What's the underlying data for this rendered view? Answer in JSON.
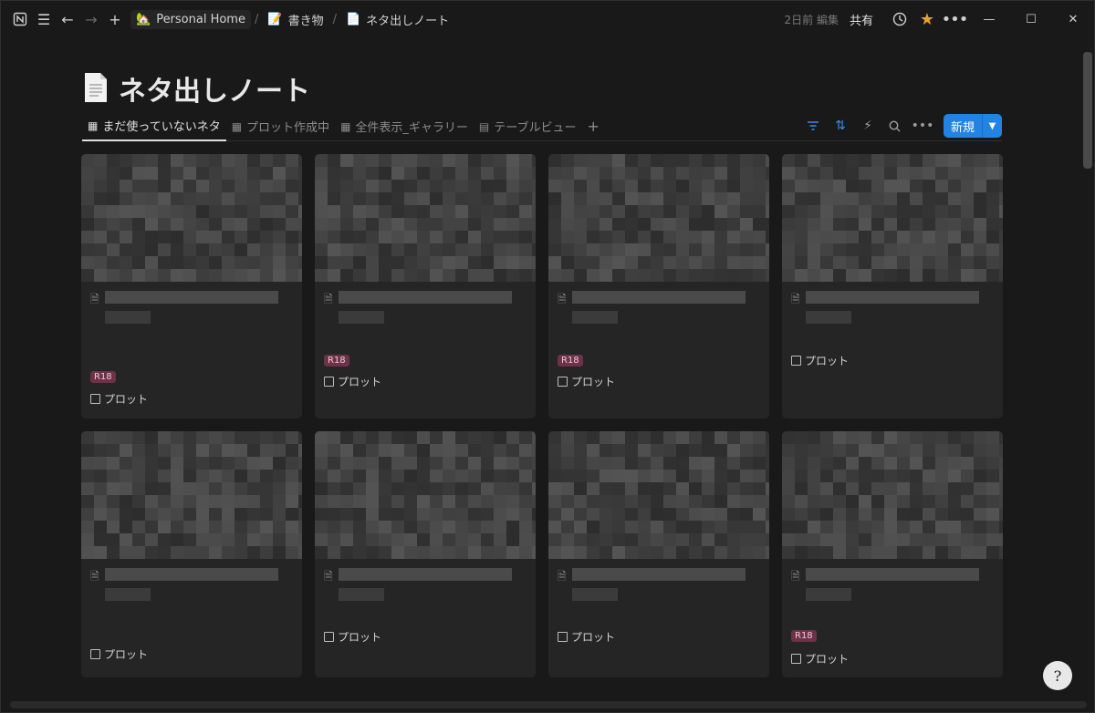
{
  "titlebar": {
    "breadcrumbs": [
      {
        "icon": "house-emoji",
        "label": "Personal Home"
      },
      {
        "icon": "memo-emoji",
        "label": "書き物"
      },
      {
        "icon": "page-icon",
        "label": "ネタ出しノート"
      }
    ],
    "edited": "2日前 編集",
    "share": "共有"
  },
  "page": {
    "title": "ネタ出しノート",
    "tabs": [
      {
        "label": "まだ使っていないネタ",
        "icon": "gallery-icon",
        "active": true
      },
      {
        "label": "プロット作成中",
        "icon": "gallery-icon"
      },
      {
        "label": "全件表示_ギャラリー",
        "icon": "gallery-icon"
      },
      {
        "label": "テーブルビュー",
        "icon": "table-icon"
      }
    ],
    "new_button": "新規"
  },
  "cards": [
    {
      "tag": "R18",
      "prop": "プロット"
    },
    {
      "tag": "R18",
      "prop": "プロット"
    },
    {
      "tag": "R18",
      "prop": "プロット"
    },
    {
      "tag": "",
      "prop": "プロット"
    },
    {
      "tag": "",
      "prop": "プロット"
    },
    {
      "tag": "",
      "prop": "プロット"
    },
    {
      "tag": "",
      "prop": "プロット"
    },
    {
      "tag": "R18",
      "prop": "プロット"
    }
  ],
  "colors": {
    "accent": "#2383e2",
    "tag_bg": "#6c3348",
    "star": "#e5a32e"
  }
}
